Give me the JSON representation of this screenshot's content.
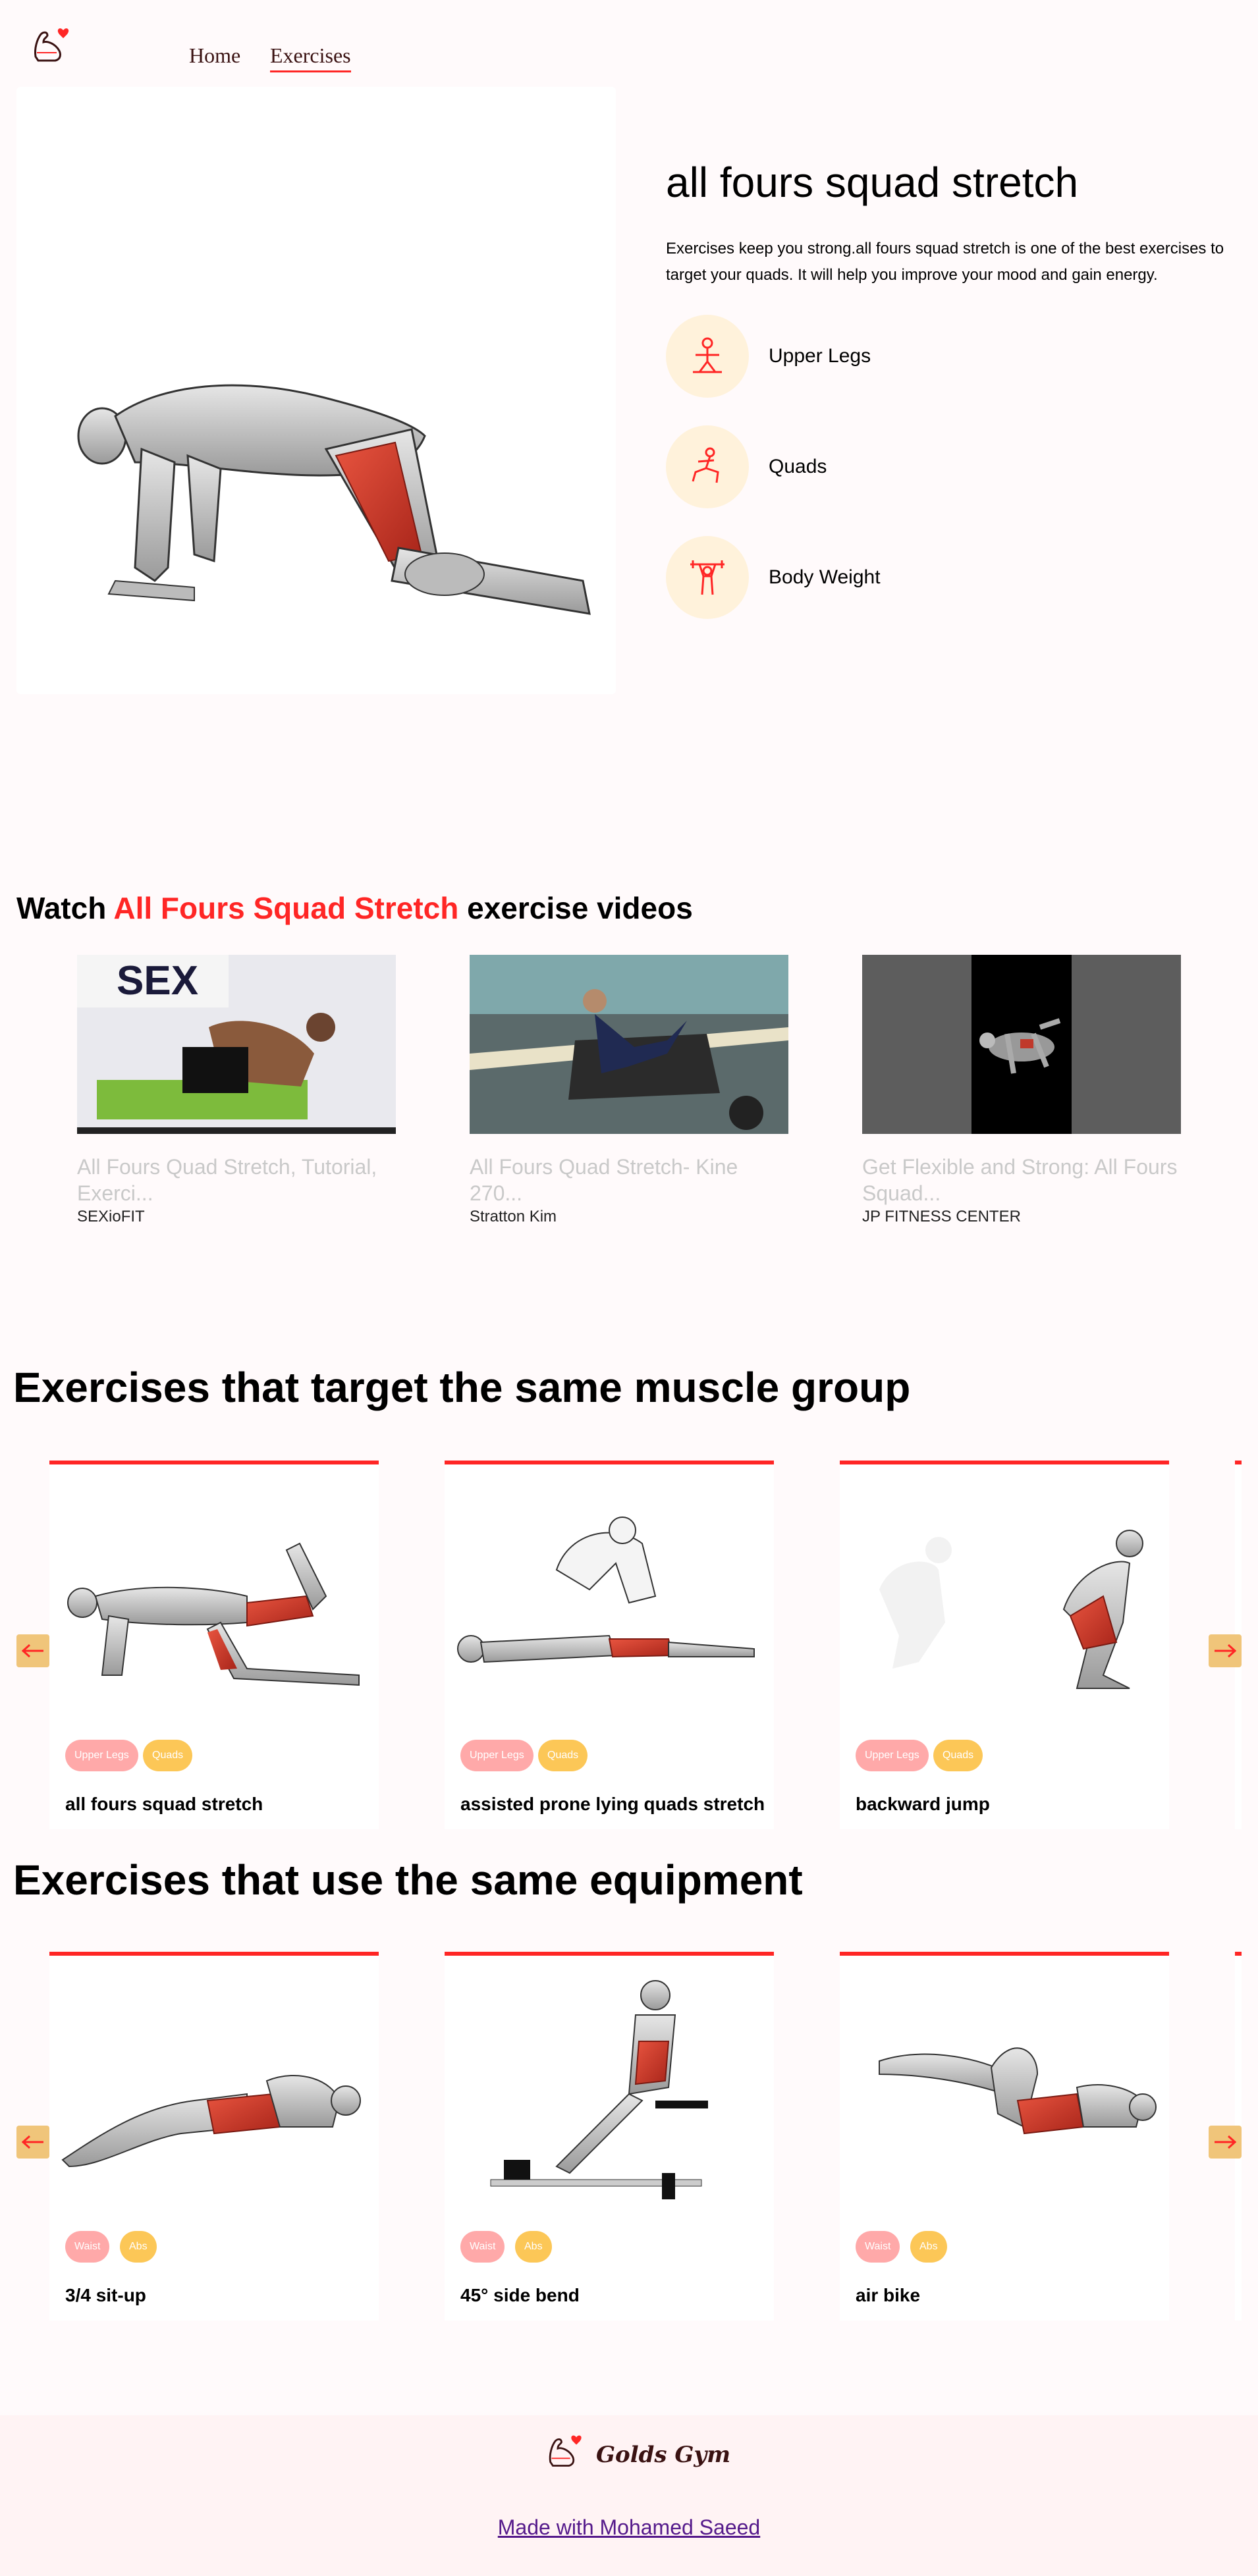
{
  "nav": {
    "logo_icon": "flexed-arm-heart-icon",
    "links": [
      {
        "label": "Home",
        "active": false
      },
      {
        "label": "Exercises",
        "active": true
      }
    ]
  },
  "hero": {
    "title": "all fours squad stretch",
    "description": "Exercises keep you strong.all fours squad stretch is one of the best exercises to target your quads. It will help you improve your mood and gain energy.",
    "details": [
      {
        "icon": "body-part-icon",
        "label": "Upper Legs"
      },
      {
        "icon": "target-icon",
        "label": "Quads"
      },
      {
        "icon": "equipment-icon",
        "label": "Body Weight"
      }
    ]
  },
  "videos": {
    "heading_prefix": "Watch",
    "heading_highlight": "All Fours Squad Stretch",
    "heading_suffix": "exercise videos",
    "items": [
      {
        "title": "All Fours Quad Stretch, Tutorial, Exerci...",
        "channel": "SEXioFIT"
      },
      {
        "title": "All Fours Quad Stretch- Kine 270...",
        "channel": "Stratton Kim"
      },
      {
        "title": "Get Flexible and Strong: All Fours Squad...",
        "channel": "JP FITNESS CENTER"
      }
    ]
  },
  "target_section": {
    "heading": "Exercises that target the same muscle group",
    "cards": [
      {
        "name": "all fours squad stretch",
        "tags": [
          "Upper Legs",
          "Quads"
        ]
      },
      {
        "name": "assisted prone lying quads stretch",
        "tags": [
          "Upper Legs",
          "Quads"
        ]
      },
      {
        "name": "backward jump",
        "tags": [
          "Upper Legs",
          "Quads"
        ]
      }
    ]
  },
  "equipment_section": {
    "heading": "Exercises that use the same equipment",
    "cards": [
      {
        "name": "3/4 sit-up",
        "tags": [
          "Waist",
          "Abs"
        ]
      },
      {
        "name": "45° side bend",
        "tags": [
          "Waist",
          "Abs"
        ]
      },
      {
        "name": "air bike",
        "tags": [
          "Waist",
          "Abs"
        ]
      }
    ]
  },
  "footer": {
    "brand": "Golds Gym",
    "credit": "Made with Mohamed Saeed"
  },
  "colors": {
    "accent": "#FF2625",
    "background": "#FFFAFB",
    "tag_bg": "#FFF2DB",
    "pill_primary": "#FFA9A9",
    "pill_secondary": "#FCC757",
    "arrow_bg": "#F0C57A",
    "footer_bg": "#FFF3F4",
    "link": "#551A8B"
  }
}
